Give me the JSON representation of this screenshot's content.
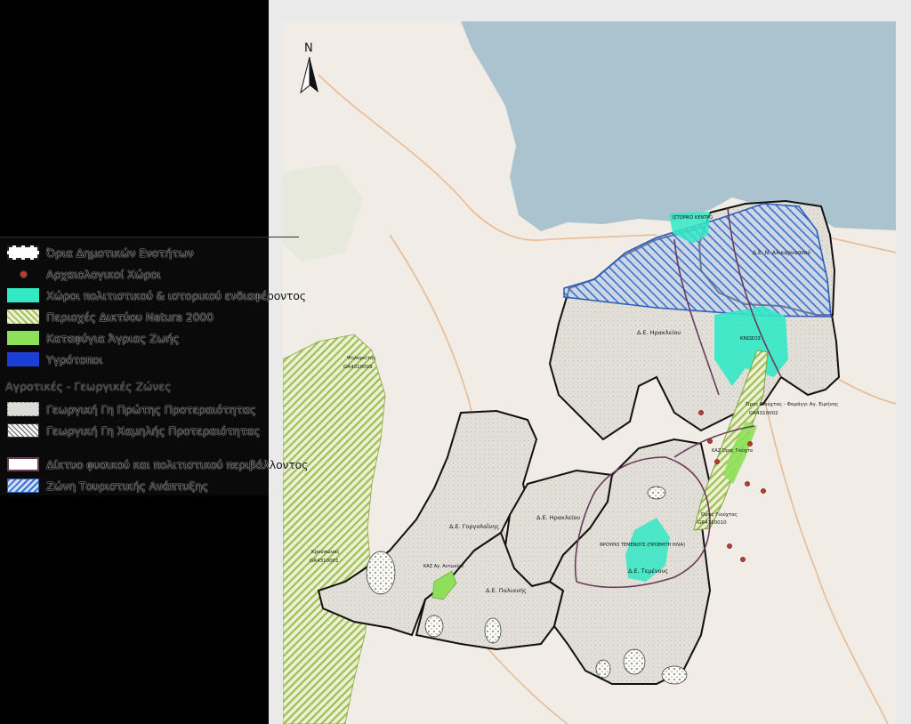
{
  "legend": {
    "items": [
      {
        "label": "Όρια Δημοτικών Ενοτήτων",
        "swatch": "boundary"
      },
      {
        "label": "Αρχαιολογικοί Χώροι",
        "swatch": "arch"
      },
      {
        "label": "Χώροι πολιτιστικού & ιστορικού ενδιαφέροντος",
        "swatch": "cultural"
      },
      {
        "label": "Περιοχές Δικτύου Natura 2000",
        "swatch": "natura"
      },
      {
        "label": "Καταφύγια Άγριας Ζωής",
        "swatch": "refuge"
      },
      {
        "label": "Υγρότοποι",
        "swatch": "wetland"
      }
    ],
    "agri_heading": "Αγροτικές - Γεωργικές Ζώνες",
    "agri_items": [
      {
        "label": "Γεωργική Γη Πρώτης Προτεραιότητας",
        "swatch": "agri1"
      },
      {
        "label": "Γεωργική Γη Χαμηλής Προτεραιότητας",
        "swatch": "agri2"
      }
    ],
    "network_items": [
      {
        "label": "Δίκτυο φυσικού και πολιτιστικού περιβάλλοντος",
        "swatch": "network"
      },
      {
        "label": "Ζώνη Τουριστικής Ανάπτυξης",
        "swatch": "tourism"
      }
    ]
  },
  "map": {
    "north_label": "N",
    "units": {
      "heraklion_main": "Δ.Ε. Ηρακλείου",
      "heraklion_sub": "Δ.Ε. Ηρακλείου",
      "alikarnassos": "Δ.Ε. Ν. Αλικαρνασσού",
      "gorgolaini": "Δ.Ε. Γοργολαΐνης",
      "paliani": "Δ.Ε. Παλιανής",
      "temenos": "Δ.Ε. Τεμένους"
    },
    "sites": {
      "historic_center": "ΙΣΤΟΡΙΚΟ ΚΕΝΤΡΟ",
      "knossos": "ΚΝΩΣΟΣ",
      "fortress_temenos": "ΦΡΟΥΡΙΟ ΤΕΜΕΝΟΥΣ (ΠΡΟΘΗΤΗ ΗΛΙΑ)",
      "kaz": "ΚΑΖ Αγ. Αντωνίου",
      "kaz_giouchta": "ΚΑΖ Όρος Γιούχτα"
    },
    "natura": {
      "giouchta_farangi": "Όρος Γιούχτας - Φαράγγι Αγ. Ειρήνης",
      "giouchta_farangi_code": "GR4310002",
      "psiloritis_west": "Ψηλορείτης",
      "psiloritis_west_code": "GR4310009",
      "krousonas": "Κρουσώνας",
      "krousonas_code": "GR4310001",
      "giouchtas": "Όρος Γιούχτας",
      "giouchtas_code": "GR4310010"
    },
    "colors": {
      "sea": "#aac3cf",
      "land": "#f1ede6",
      "agri_first": "#dedcd3",
      "cultural": "#33e8c5",
      "natura": "#9cbf55",
      "refuge": "#8ee05a",
      "tourism": "#3a6fd0",
      "boundary": "#111111",
      "network": "#6a3b5a",
      "roads": "#e8b58c"
    }
  }
}
